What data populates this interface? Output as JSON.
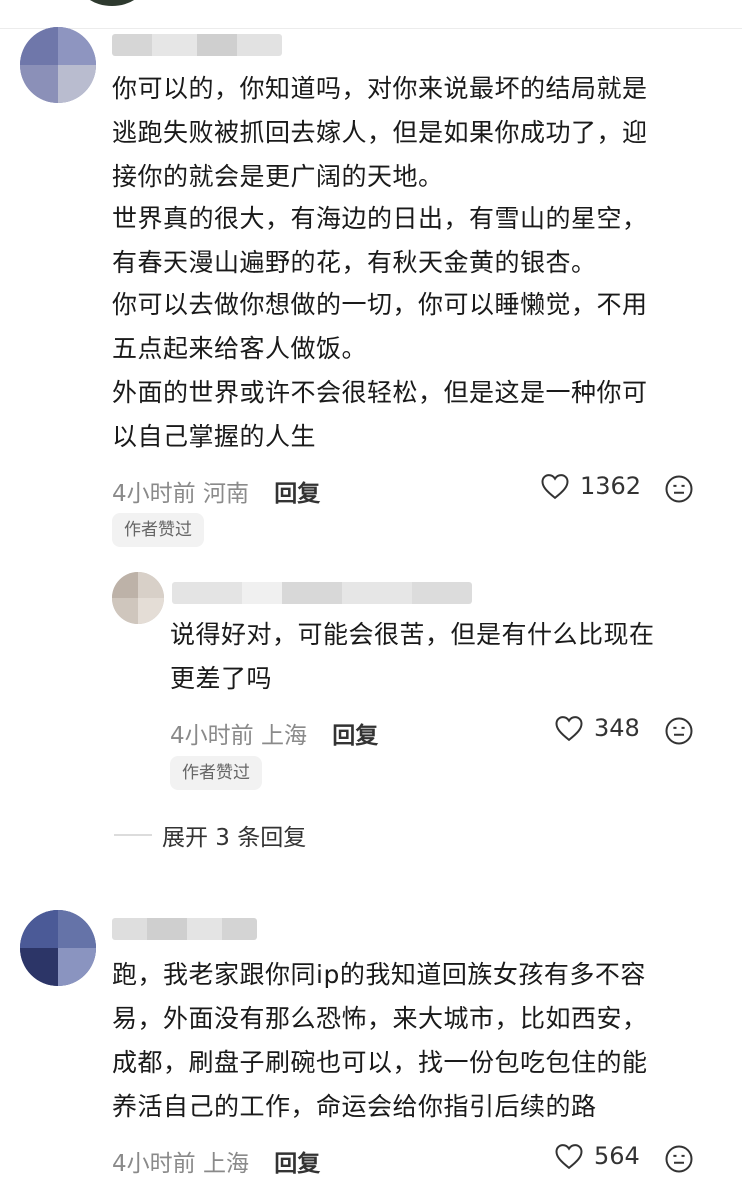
{
  "comments": [
    {
      "lines": [
        "你可以的，你知道吗，对你来说最坏的结局就是",
        "逃跑失败被抓回去嫁人，但是如果你成功了，迎",
        "接你的就会是更广阔的天地。",
        "世界真的很大，有海边的日出，有雪山的星空，",
        "有春天漫山遍野的花，有秋天金黄的银杏。",
        "你可以去做你想做的一切，你可以睡懒觉，不用",
        "五点起来给客人做饭。",
        "外面的世界或许不会很轻松，但是这是一种你可",
        "以自己掌握的人生"
      ],
      "time": "4小时前",
      "location": "河南",
      "reply_label": "回复",
      "likes": "1362",
      "badge": "作者赞过"
    },
    {
      "lines": [
        "跑，我老家跟你同ip的我知道回族女孩有多不容",
        "易，外面没有那么恐怖，来大城市，比如西安，",
        "成都，刷盘子刷碗也可以，找一份包吃包住的能",
        "养活自己的工作，命运会给你指引后续的路"
      ],
      "time": "4小时前",
      "location": "上海",
      "reply_label": "回复",
      "likes": "564"
    }
  ],
  "reply": {
    "lines": [
      "说得好对，可能会很苦，但是有什么比现在",
      "更差了吗"
    ],
    "time": "4小时前",
    "location": "上海",
    "reply_label": "回复",
    "likes": "348",
    "badge": "作者赞过"
  },
  "expand_label": "展开 3 条回复",
  "icons": {
    "like": "heart-outline-icon",
    "dislike": "neutral-face-icon"
  },
  "colors": {
    "text": "#1a1a1a",
    "meta": "#8a8a8a",
    "badge_bg": "#f2f2f2"
  }
}
